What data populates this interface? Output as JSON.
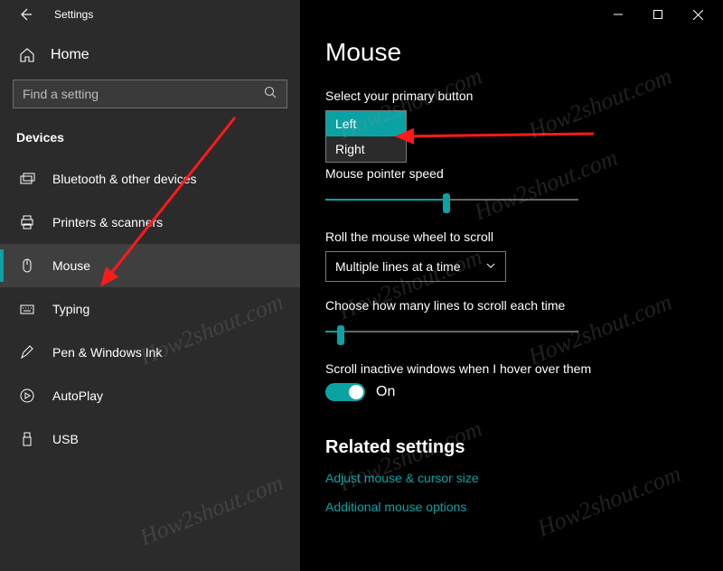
{
  "window": {
    "title": "Settings"
  },
  "sidebar": {
    "home": "Home",
    "search_placeholder": "Find a setting",
    "section": "Devices",
    "items": [
      {
        "label": "Bluetooth & other devices"
      },
      {
        "label": "Printers & scanners"
      },
      {
        "label": "Mouse"
      },
      {
        "label": "Typing"
      },
      {
        "label": "Pen & Windows Ink"
      },
      {
        "label": "AutoPlay"
      },
      {
        "label": "USB"
      }
    ]
  },
  "main": {
    "heading": "Mouse",
    "primary_button_label": "Select your primary button",
    "primary_options": {
      "left": "Left",
      "right": "Right"
    },
    "pointer_speed_label": "Mouse pointer speed",
    "wheel_label": "Roll the mouse wheel to scroll",
    "wheel_value": "Multiple lines at a time",
    "lines_label": "Choose how many lines to scroll each time",
    "inactive_label": "Scroll inactive windows when I hover over them",
    "toggle_state": "On",
    "related_heading": "Related settings",
    "link1": "Adjust mouse & cursor size",
    "link2": "Additional mouse options"
  },
  "watermark": "How2shout.com"
}
